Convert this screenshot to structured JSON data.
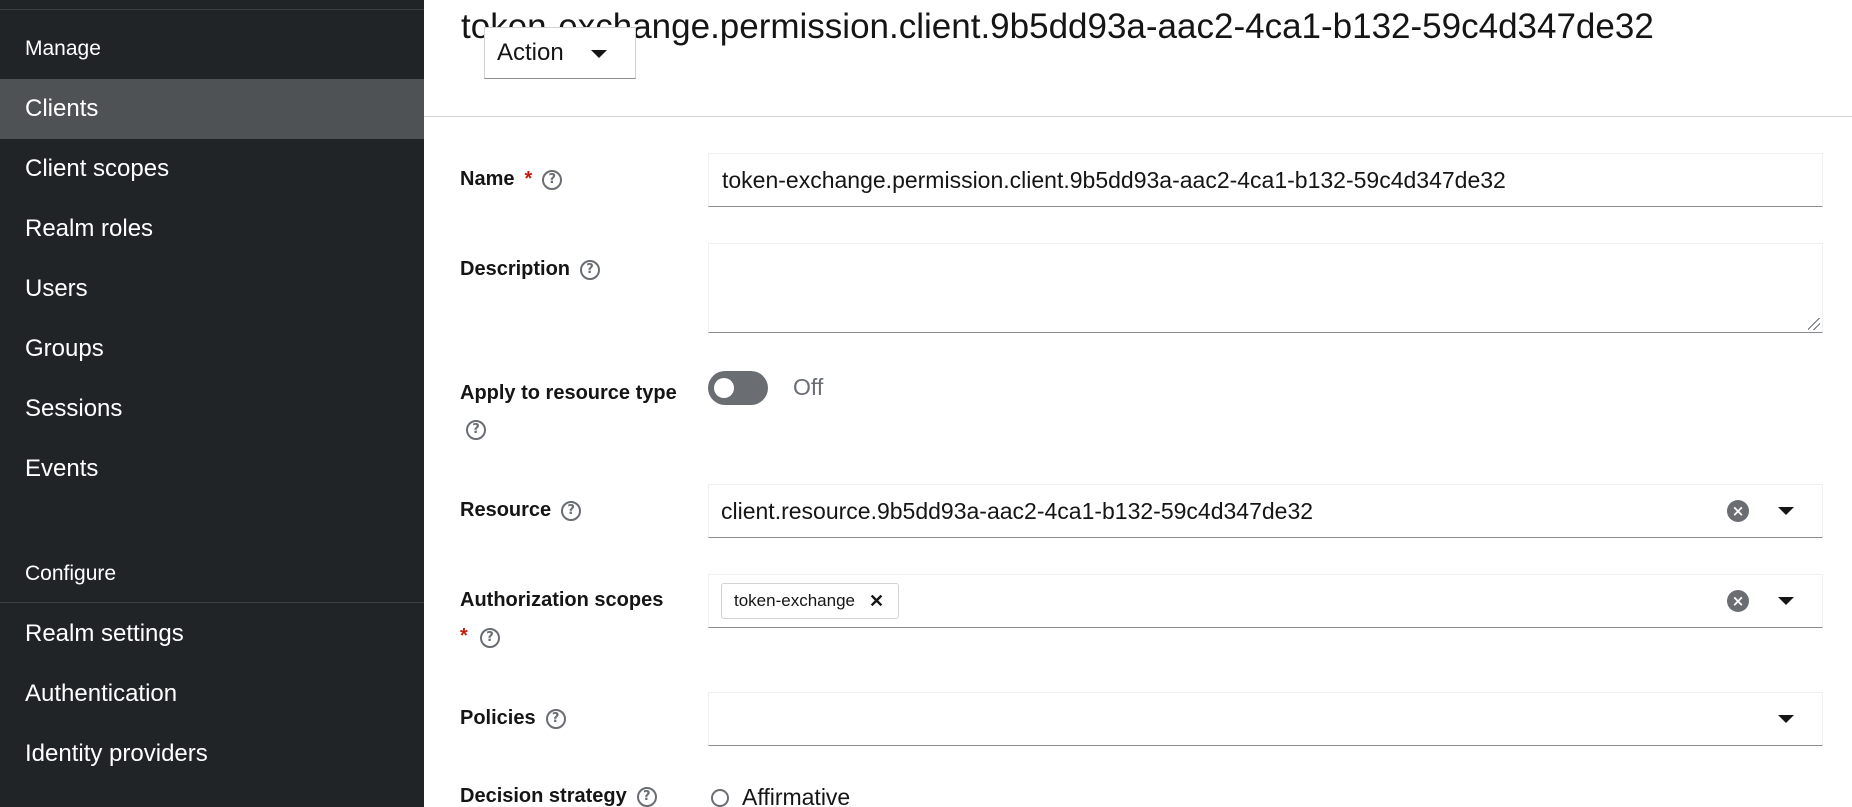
{
  "sidebar": {
    "sections": [
      {
        "title": "Manage",
        "items": [
          {
            "label": "Clients",
            "active": true
          },
          {
            "label": "Client scopes"
          },
          {
            "label": "Realm roles"
          },
          {
            "label": "Users"
          },
          {
            "label": "Groups"
          },
          {
            "label": "Sessions"
          },
          {
            "label": "Events"
          }
        ]
      },
      {
        "title": "Configure",
        "items": [
          {
            "label": "Realm settings"
          },
          {
            "label": "Authentication"
          },
          {
            "label": "Identity providers"
          }
        ]
      }
    ]
  },
  "header": {
    "title": "token-exchange.permission.client.9b5dd93a-aac2-4ca1-b132-59c4d347de32",
    "action_label": "Action"
  },
  "form": {
    "name": {
      "label": "Name",
      "value": "token-exchange.permission.client.9b5dd93a-aac2-4ca1-b132-59c4d347de32"
    },
    "description": {
      "label": "Description",
      "value": ""
    },
    "apply_resource_type": {
      "label": "Apply to resource type",
      "state_label": "Off",
      "enabled": false
    },
    "resource": {
      "label": "Resource",
      "value": "client.resource.9b5dd93a-aac2-4ca1-b132-59c4d347de32"
    },
    "authorization_scopes": {
      "label": "Authorization scopes",
      "chips": [
        "token-exchange"
      ]
    },
    "policies": {
      "label": "Policies",
      "value": ""
    },
    "decision_strategy": {
      "label": "Decision strategy",
      "options": [
        "Affirmative"
      ]
    }
  },
  "icons": {
    "help": "help-circle-icon",
    "clear": "times-circle-icon",
    "caret": "caret-down-icon"
  },
  "colors": {
    "sidebar_bg": "#212427",
    "sidebar_active": "#4f5255",
    "required": "#c9190b"
  }
}
